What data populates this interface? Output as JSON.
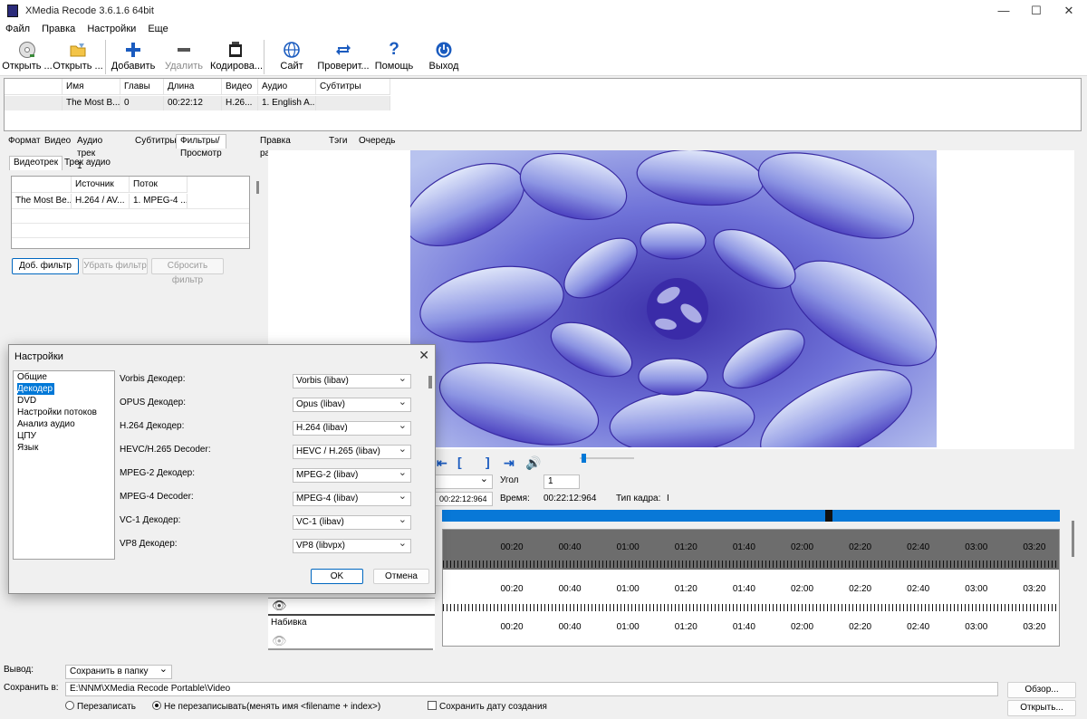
{
  "window": {
    "title": "XMedia Recode 3.6.1.6 64bit",
    "controls": {
      "minimize": "—",
      "maximize": "☐",
      "close": "✕"
    }
  },
  "menu": [
    "Файл",
    "Правка",
    "Настройки",
    "Еще"
  ],
  "toolbar": {
    "open_file": "Открыть ...",
    "open_disc": "Открыть ...",
    "add": "Добавить",
    "remove": "Удалить",
    "encode": "Кодирова...",
    "site": "Сайт",
    "check": "Проверит...",
    "help": "Помощь",
    "exit": "Выход"
  },
  "file_list": {
    "columns": [
      "Имя",
      "Главы",
      "Длина",
      "Видео",
      "Аудио",
      "Субтитры"
    ],
    "rows": [
      [
        "The Most B...",
        "0",
        "00:22:12",
        "H.26...",
        "1. English A...",
        ""
      ]
    ]
  },
  "tabs": [
    "Формат",
    "Видео",
    "Аудио трек 1",
    "Субтитры",
    "Фильтры/Просмотр",
    "Правка раздела",
    "Тэги",
    "Очередь"
  ],
  "active_tab": "Фильтры/Просмотр",
  "left_panel": {
    "subtabs": [
      "Видеотрек",
      "Трек аудио"
    ],
    "track_table": {
      "columns": [
        "",
        "Источник",
        "Поток"
      ],
      "rows": [
        [
          "The Most Be...",
          "H.264 / AV...",
          "1. MPEG-4 ..."
        ]
      ]
    },
    "buttons": {
      "add_filter": "Доб. фильтр",
      "remove_filter": "Убрать фильтр",
      "reset_filter": "Сбросить фильтр"
    }
  },
  "player": {
    "angle_label": "Угол",
    "angle_value": "1",
    "time_field": "00:22:12:964",
    "time_label": "Время:",
    "time_value": "00:22:12:964",
    "frame_type_label": "Тип кадра:",
    "frame_type_value": "I",
    "playhead_fraction": 0.62
  },
  "timeline": {
    "labels": [
      "00:20",
      "00:40",
      "01:00",
      "01:20",
      "01:40",
      "02:00",
      "02:20",
      "02:40",
      "03:00",
      "03:20"
    ],
    "track_label": "Набивка"
  },
  "bottom": {
    "output_label": "Вывод:",
    "output_value": "Сохранить в папку",
    "save_to_label": "Сохранить в:",
    "save_path": "E:\\NNM\\XMedia Recode Portable\\Video",
    "browse": "Обзор...",
    "open": "Открыть...",
    "overwrite": "Перезаписать",
    "no_overwrite": "Не перезаписывать(менять имя <filename + index>)",
    "keep_date": "Сохранить дату создания"
  },
  "dialog": {
    "title": "Настройки",
    "nav": [
      "Общие",
      "Декодер",
      "DVD",
      "Настройки потоков",
      "Анализ аудио",
      "ЦПУ",
      "Язык"
    ],
    "selected": "Декодер",
    "decoders": [
      {
        "label": "Vorbis Декодер:",
        "value": "Vorbis (libav)"
      },
      {
        "label": "OPUS Декодер:",
        "value": "Opus (libav)"
      },
      {
        "label": "H.264 Декодер:",
        "value": "H.264 (libav)"
      },
      {
        "label": "HEVC/H.265 Decoder:",
        "value": "HEVC / H.265 (libav)"
      },
      {
        "label": "MPEG-2 Декодер:",
        "value": "MPEG-2 (libav)"
      },
      {
        "label": "MPEG-4 Decoder:",
        "value": "MPEG-4 (libav)"
      },
      {
        "label": "VC-1 Декодер:",
        "value": "VC-1 (libav)"
      },
      {
        "label": "VP8 Декодер:",
        "value": "VP8 (libvpx)"
      }
    ],
    "ok": "OK",
    "cancel": "Отмена"
  },
  "colors": {
    "accent": "#0078d7",
    "timeline": "#0878d7",
    "toolbar_icon": "#1a5bbf"
  }
}
